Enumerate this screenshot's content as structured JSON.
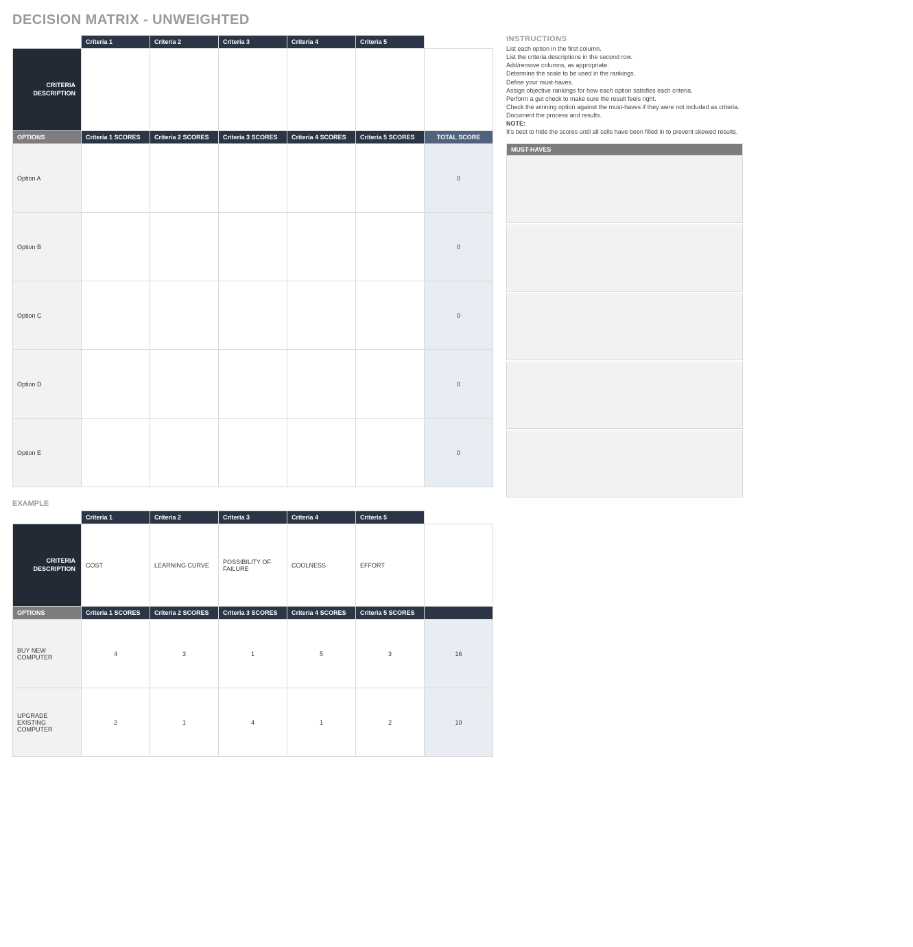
{
  "title": "DECISION MATRIX - UNWEIGHTED",
  "headers": {
    "criteria": [
      "Criteria 1",
      "Criteria 2",
      "Criteria 3",
      "Criteria 4",
      "Criteria 5"
    ],
    "criteria_description": "CRITERIA DESCRIPTION",
    "options": "OPTIONS",
    "scores": [
      "Criteria 1 SCORES",
      "Criteria 2 SCORES",
      "Criteria 3 SCORES",
      "Criteria 4 SCORES",
      "Criteria 5 SCORES"
    ],
    "total_score": "TOTAL SCORE"
  },
  "criteria_descriptions": [
    "",
    "",
    "",
    "",
    ""
  ],
  "options": [
    {
      "name": "Option A",
      "scores": [
        "",
        "",
        "",
        "",
        ""
      ],
      "total": "0"
    },
    {
      "name": "Option B",
      "scores": [
        "",
        "",
        "",
        "",
        ""
      ],
      "total": "0"
    },
    {
      "name": "Option C",
      "scores": [
        "",
        "",
        "",
        "",
        ""
      ],
      "total": "0"
    },
    {
      "name": "Option D",
      "scores": [
        "",
        "",
        "",
        "",
        ""
      ],
      "total": "0"
    },
    {
      "name": "Option E",
      "scores": [
        "",
        "",
        "",
        "",
        ""
      ],
      "total": "0"
    }
  ],
  "example": {
    "title": "EXAMPLE",
    "criteria_descriptions": [
      "COST",
      "LEARNING CURVE",
      "POSSIBILITY OF FAILURE",
      "COOLNESS",
      "EFFORT"
    ],
    "options": [
      {
        "name": "BUY NEW COMPUTER",
        "scores": [
          "4",
          "3",
          "1",
          "5",
          "3"
        ],
        "total": "16"
      },
      {
        "name": "UPGRADE EXISTING COMPUTER",
        "scores": [
          "2",
          "1",
          "4",
          "1",
          "2"
        ],
        "total": "10"
      }
    ]
  },
  "instructions": {
    "title": "INSTRUCTIONS",
    "lines": [
      "List each option in the first column.",
      "List the criteria descriptions in the second row.",
      "Add/remove columns, as appropriate.",
      "Determine the scale to be used in the rankings.",
      "Define your must-haves.",
      "Assign objective rankings for how each option satisfies each criteria.",
      "Perform a gut check to make sure the result feels right.",
      "Check the winning option against the must-haves if they were not included as criteria.",
      "Document the process and results."
    ],
    "note_label": "NOTE:",
    "note_text": "It's best to hide the scores until all cells have been filled in to prevent skewed results."
  },
  "must_haves": {
    "title": "MUST-HAVES",
    "items": [
      "",
      "",
      "",
      "",
      ""
    ]
  }
}
